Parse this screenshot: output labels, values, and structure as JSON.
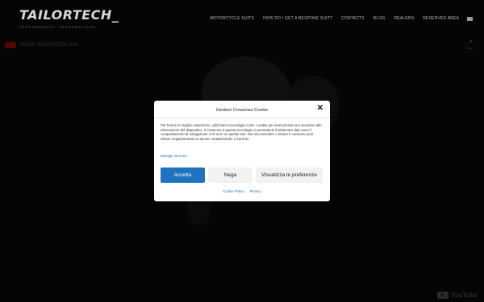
{
  "header": {
    "logo_text": "TAILORTECH_",
    "logo_tagline": "PERFORMANCE. PERSONALIZED.",
    "nav": [
      "MOTORCYCLE SUITS",
      "HOW DO I GET A BESPOKE SUIT?",
      "CONTACTS",
      "BLOG",
      "DEALERS",
      "RESERVED AREA"
    ]
  },
  "video": {
    "title": "Perché TAILORTECH suits",
    "share_label": "Share",
    "youtube_label": "YouTube"
  },
  "cookie_modal": {
    "title": "Gestisci Consenso Cookie",
    "body": "Per fornire le migliori esperienze, utilizziamo tecnologie come i cookie per memorizzare e/o accedere alle informazioni del dispositivo. Il consenso a queste tecnologie ci permetterà di elaborare dati come il comportamento di navigazione o ID unici su questo sito. Non acconsentire o ritirare il consenso può influire negativamente su alcune caratteristiche e funzioni.",
    "manage_services": "Manage services",
    "accept_label": "Accetta",
    "deny_label": "Nega",
    "preferences_label": "Visualizza le preferenze",
    "links": [
      "Cookie Policy",
      "Privacy"
    ]
  },
  "colors": {
    "accent": "#1e73be",
    "link": "#1f6dc0",
    "modal_bg": "#ffffff",
    "page_bg": "#000000"
  }
}
